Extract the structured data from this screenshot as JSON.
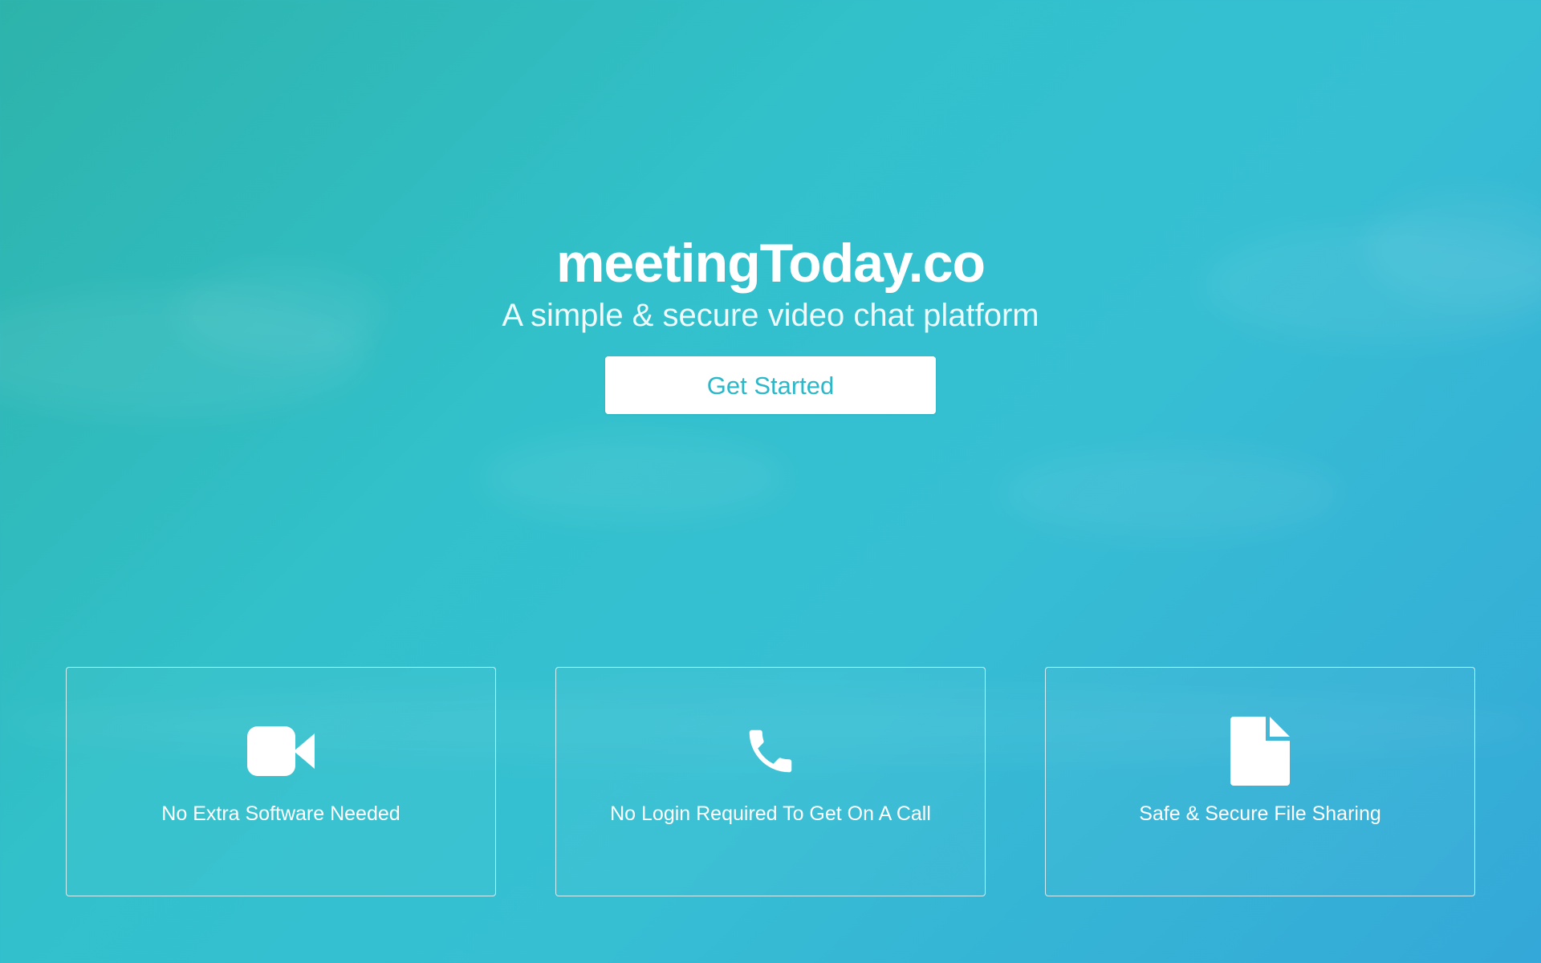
{
  "hero": {
    "title": "meetingToday.co",
    "subtitle": "A simple & secure video chat platform",
    "cta_label": "Get Started"
  },
  "features": [
    {
      "icon": "video-camera-icon",
      "label": "No Extra Software Needed"
    },
    {
      "icon": "phone-icon",
      "label": "No Login Required To Get On A Call"
    },
    {
      "icon": "document-icon",
      "label": "Safe & Secure File Sharing"
    }
  ],
  "colors": {
    "background_start": "#2db3aa",
    "background_end": "#34a8d8",
    "button_text": "#2cb8c8",
    "text": "#ffffff"
  }
}
